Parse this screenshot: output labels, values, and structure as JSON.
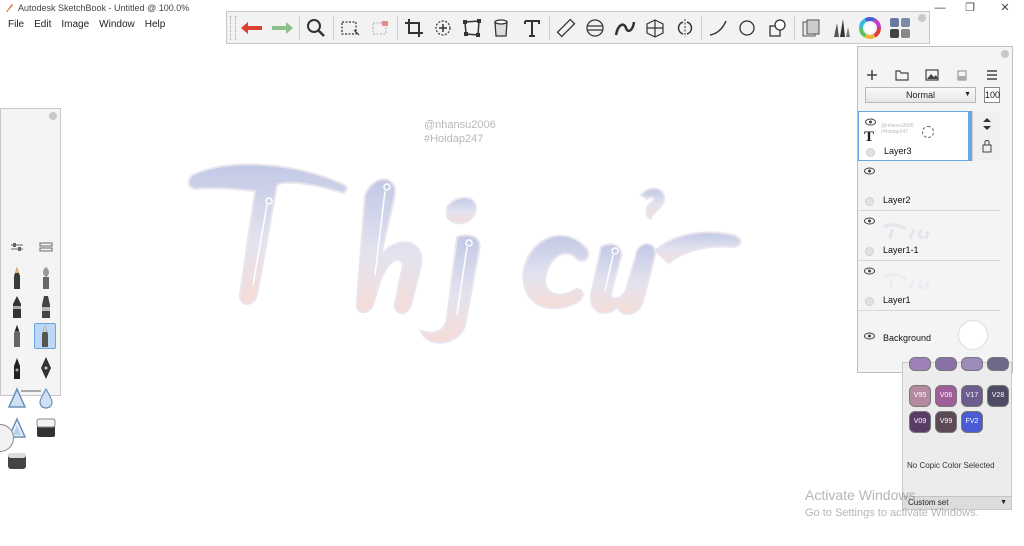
{
  "window": {
    "title": "Autodesk SketchBook - Untitled @ 100.0%",
    "minimize": "—",
    "restore": "❐",
    "close": "✕"
  },
  "menu": [
    "File",
    "Edit",
    "Image",
    "Window",
    "Help"
  ],
  "toolbar": {
    "tools": [
      "undo-icon",
      "redo-icon",
      "zoom-icon",
      "rectangle-select-icon",
      "lasso-select-icon",
      "crop-icon",
      "transform-icon",
      "distort-icon",
      "fill-bucket-icon",
      "text-icon",
      "ruler-icon",
      "ellipse-guide-icon",
      "french-curve-icon",
      "perspective-icon",
      "symmetry-icon",
      "line-icon",
      "circle-icon",
      "shape-icon",
      "copic-library-icon",
      "brush-library-icon",
      "color-wheel-icon",
      "swatches-icon"
    ]
  },
  "canvas": {
    "watermark_line1": "@nhansu2006",
    "watermark_line2": "#Hoidap247"
  },
  "layers": {
    "blend_mode": "Normal",
    "opacity": "100",
    "items": [
      {
        "name": "Layer3",
        "thumb_text_1": "@nhansu2006",
        "thumb_text_2": "#Hoidap247"
      },
      {
        "name": "Layer2"
      },
      {
        "name": "Layer1-1"
      },
      {
        "name": "Layer1"
      },
      {
        "name": "Background"
      }
    ]
  },
  "copic": {
    "swatches": [
      {
        "code": "V95",
        "color": "#b48aa0"
      },
      {
        "code": "V06",
        "color": "#a05d97"
      },
      {
        "code": "V17",
        "color": "#6d5d8c"
      },
      {
        "code": "V28",
        "color": "#4e4a66"
      },
      {
        "code": "V09",
        "color": "#5a3d66"
      },
      {
        "code": "V99",
        "color": "#5c4a57"
      },
      {
        "code": "FV2",
        "color": "#4a5bd6"
      }
    ],
    "status": "No Copic Color Selected",
    "set_label": "Custom set"
  },
  "os_watermark": {
    "line1": "Activate Windows",
    "line2": "Go to Settings to activate Windows."
  }
}
